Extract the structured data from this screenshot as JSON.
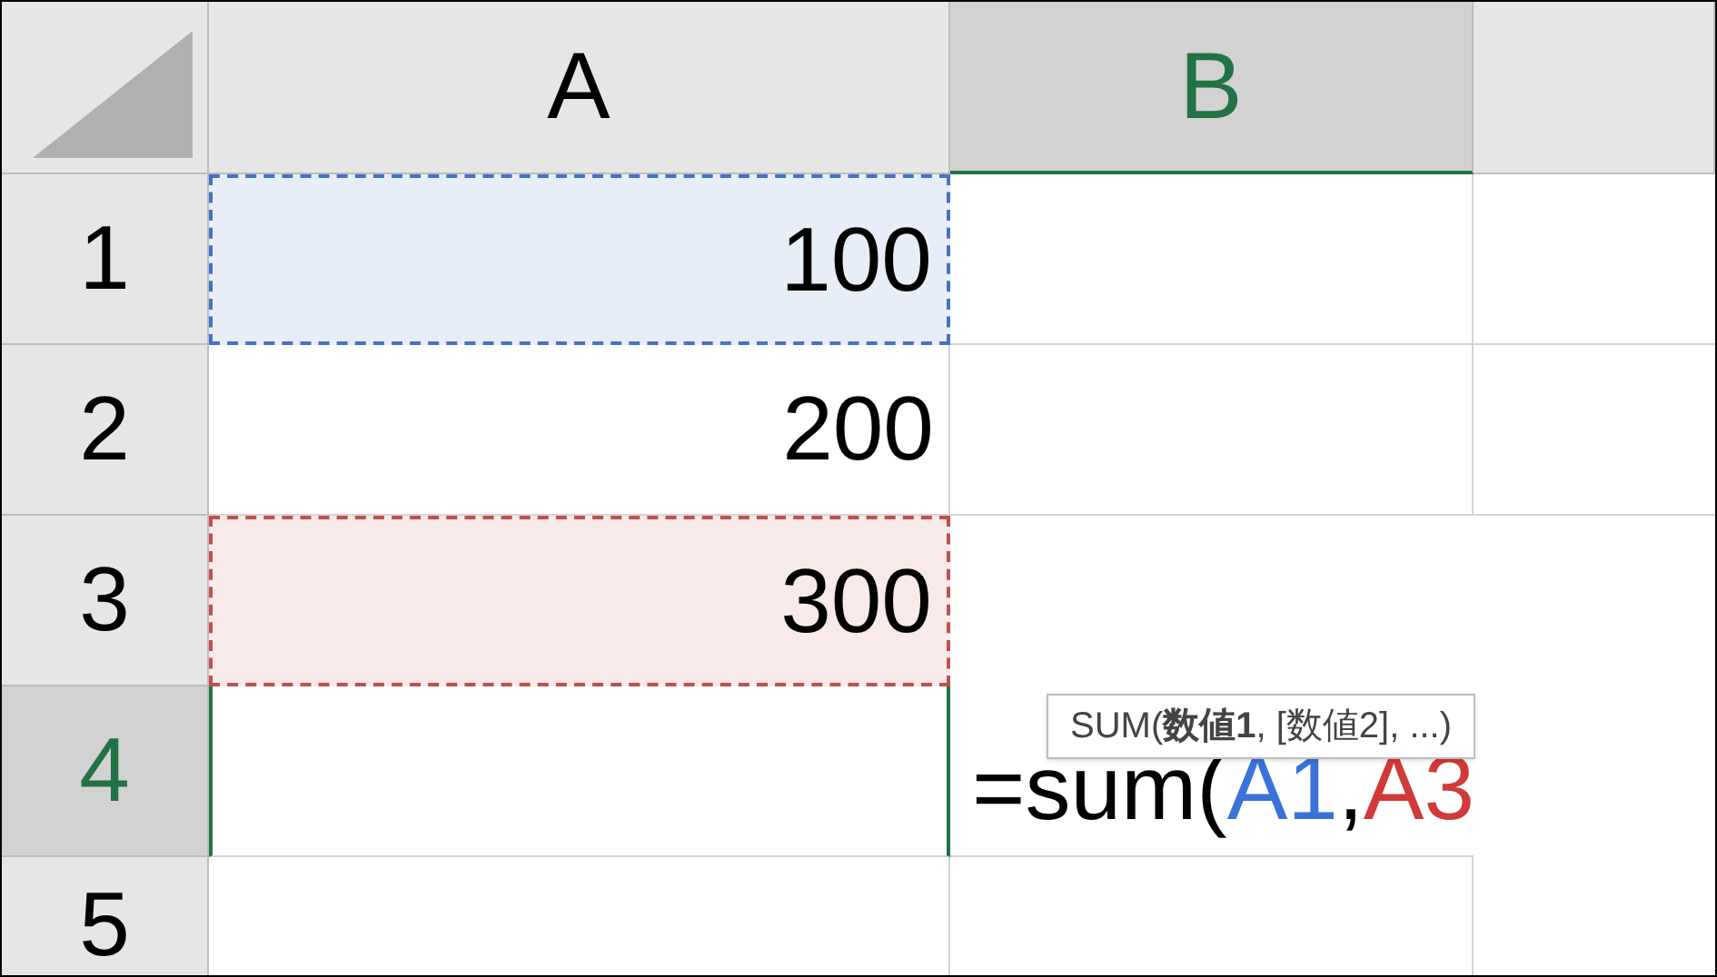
{
  "columns": [
    {
      "label": "A",
      "selected": false
    },
    {
      "label": "B",
      "selected": true
    },
    {
      "selected": false
    }
  ],
  "rows": [
    {
      "label": "1",
      "selected": false,
      "cells": [
        {
          "value": "100",
          "color": "#4472c4"
        }
      ]
    },
    {
      "label": "2",
      "selected": false,
      "cells": [
        {
          "value": "200"
        }
      ]
    },
    {
      "label": "3",
      "selected": false,
      "cells": [
        {
          "value": "300",
          "color": "#c0504d"
        }
      ]
    },
    {
      "label": "4",
      "selected": true,
      "cells": [
        {
          "active": true
        }
      ]
    },
    {
      "label": "5",
      "selected": false,
      "cells": [
        {}
      ]
    }
  ],
  "formula": {
    "parts": [
      {
        "text": "=sum(",
        "color": "#000000"
      },
      {
        "text": "A1",
        "color": "#3a72d8"
      },
      {
        "text": ",",
        "color": "#000000"
      },
      {
        "text": "A3",
        "color": "#d03a3a"
      }
    ],
    "tooltip": "SUM(**数値1**, [数値2], ...)"
  }
}
